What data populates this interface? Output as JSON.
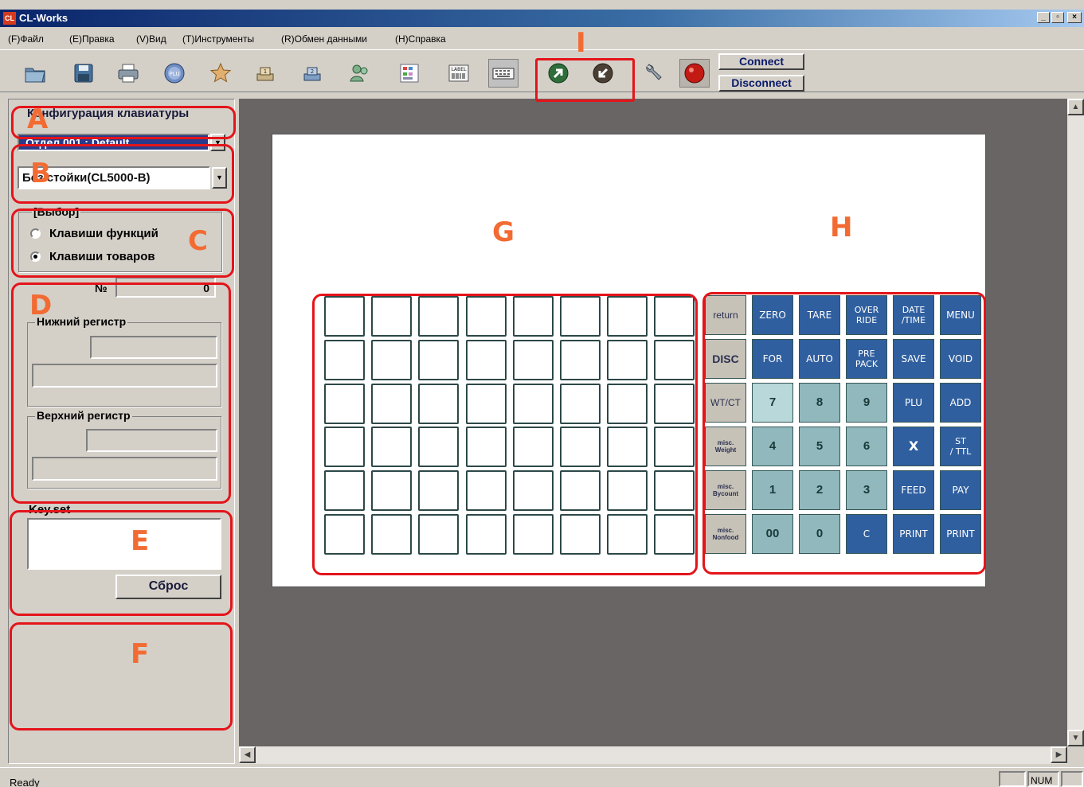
{
  "window": {
    "title": "CL-Works",
    "icon_text": "CL",
    "min": "_",
    "max": "▫",
    "close": "×"
  },
  "menu": [
    "(F)Файл",
    "(E)Правка",
    "(V)Вид",
    "(T)Инструменты",
    "(R)Обмен данными",
    "(H)Справка"
  ],
  "toolbar": {
    "icons": [
      "open-folder-icon",
      "save-disk-icon",
      "print-icon",
      "plu-icon",
      "favorite-star-icon",
      "scale-1-icon",
      "scale-2-icon",
      "users-icon",
      "palette-icon",
      "label-icon",
      "keyboard-icon",
      "send-up-icon",
      "receive-down-icon",
      "tools-icon",
      "record-icon"
    ],
    "plu_text": "PLU",
    "label_text": "LABEL",
    "badge1": "1",
    "badge2": "2",
    "connect": "Connect",
    "disconnect": "Disconnect"
  },
  "left": {
    "title": "Конфигурация клавиатуры",
    "dept_value": "Отдел 001 : Default",
    "model_value": "Без стойки(CL5000-B)",
    "select_group": "[Выбор]",
    "radio_functions": "Клавиши функций",
    "radio_goods": "Клавиши товаров",
    "radio_checked": "goods",
    "num_label": "№",
    "num_value": "0",
    "lower_label": "Нижний регистр",
    "upper_label": "Верхний регистр",
    "keyset_label": "Key.set",
    "reset_button": "Сброс"
  },
  "annotations": {
    "A": "A",
    "B": "B",
    "C": "C",
    "D": "D",
    "E": "E",
    "F": "F",
    "G": "G",
    "H": "H",
    "I": "I"
  },
  "function_keys": [
    [
      {
        "t": "return",
        "s": "gray"
      },
      {
        "t": "ZERO",
        "s": "blue"
      },
      {
        "t": "TARE",
        "s": "blue"
      },
      {
        "t": "OVER\nRIDE",
        "s": "blue"
      },
      {
        "t": "DATE\n/TIME",
        "s": "blue"
      },
      {
        "t": "MENU",
        "s": "blue"
      }
    ],
    [
      {
        "t": "DISC",
        "s": "gray-bold"
      },
      {
        "t": "FOR",
        "s": "blue"
      },
      {
        "t": "AUTO",
        "s": "blue"
      },
      {
        "t": "PRE\nPACK",
        "s": "blue"
      },
      {
        "t": "SAVE",
        "s": "blue"
      },
      {
        "t": "VOID",
        "s": "blue"
      }
    ],
    [
      {
        "t": "WT/CT",
        "s": "gray"
      },
      {
        "t": "7",
        "s": "light"
      },
      {
        "t": "8",
        "s": "teal"
      },
      {
        "t": "9",
        "s": "teal"
      },
      {
        "t": "PLU",
        "s": "blue"
      },
      {
        "t": "ADD",
        "s": "blue"
      }
    ],
    [
      {
        "t": "misc.\nWeight",
        "s": "gray-small"
      },
      {
        "t": "4",
        "s": "teal"
      },
      {
        "t": "5",
        "s": "teal"
      },
      {
        "t": "6",
        "s": "teal"
      },
      {
        "t": "X",
        "s": "blue-bold"
      },
      {
        "t": "ST\n/ TTL",
        "s": "blue"
      }
    ],
    [
      {
        "t": "misc.\nBycount",
        "s": "gray-small"
      },
      {
        "t": "1",
        "s": "teal"
      },
      {
        "t": "2",
        "s": "teal"
      },
      {
        "t": "3",
        "s": "teal"
      },
      {
        "t": "FEED",
        "s": "blue"
      },
      {
        "t": "PAY",
        "s": "blue"
      }
    ],
    [
      {
        "t": "misc.\nNonfood",
        "s": "gray-small"
      },
      {
        "t": "00",
        "s": "teal"
      },
      {
        "t": "0",
        "s": "teal"
      },
      {
        "t": "C",
        "s": "blue"
      },
      {
        "t": "PRINT",
        "s": "blue"
      },
      {
        "t": "PRINT",
        "s": "blue"
      }
    ]
  ],
  "goods_grid": {
    "rows": 6,
    "cols": 8
  },
  "status": {
    "text": "Ready",
    "num": "NUM"
  }
}
